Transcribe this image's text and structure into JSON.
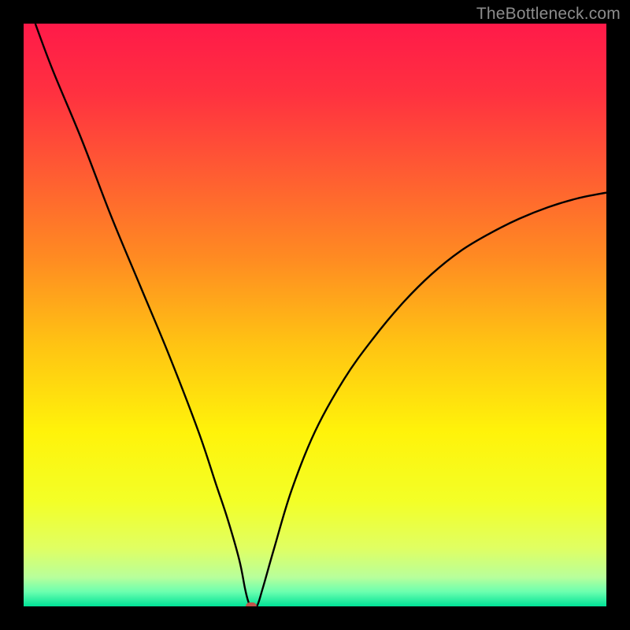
{
  "watermark": "TheBottleneck.com",
  "chart_data": {
    "type": "line",
    "title": "",
    "xlabel": "",
    "ylabel": "",
    "xlim": [
      0,
      100
    ],
    "ylim": [
      0,
      100
    ],
    "grid": false,
    "legend": false,
    "background_gradient": {
      "stops": [
        {
          "pos": 0.0,
          "color": "#ff1a49"
        },
        {
          "pos": 0.12,
          "color": "#ff3140"
        },
        {
          "pos": 0.25,
          "color": "#ff5a33"
        },
        {
          "pos": 0.4,
          "color": "#ff8a22"
        },
        {
          "pos": 0.55,
          "color": "#ffc313"
        },
        {
          "pos": 0.7,
          "color": "#fff30a"
        },
        {
          "pos": 0.82,
          "color": "#f3ff27"
        },
        {
          "pos": 0.9,
          "color": "#e0ff62"
        },
        {
          "pos": 0.95,
          "color": "#b8ff9b"
        },
        {
          "pos": 0.975,
          "color": "#6bffaf"
        },
        {
          "pos": 1.0,
          "color": "#00e297"
        }
      ]
    },
    "series": [
      {
        "name": "bottleneck-curve",
        "color": "#000000",
        "x": [
          2,
          5,
          10,
          15,
          20,
          25,
          30,
          33,
          35,
          37,
          38,
          38.5,
          39,
          40,
          41,
          43,
          46,
          50,
          55,
          60,
          65,
          70,
          75,
          80,
          85,
          90,
          95,
          100
        ],
        "y": [
          100,
          92,
          80,
          67,
          55,
          43,
          30,
          21,
          15,
          8,
          3,
          1,
          0,
          0,
          3,
          10,
          20,
          30,
          39,
          46,
          52,
          57,
          61,
          64,
          66.5,
          68.5,
          70,
          71
        ]
      }
    ],
    "marker": {
      "name": "optimal-point",
      "x": 39,
      "y": 0,
      "color": "#c0544b"
    }
  }
}
